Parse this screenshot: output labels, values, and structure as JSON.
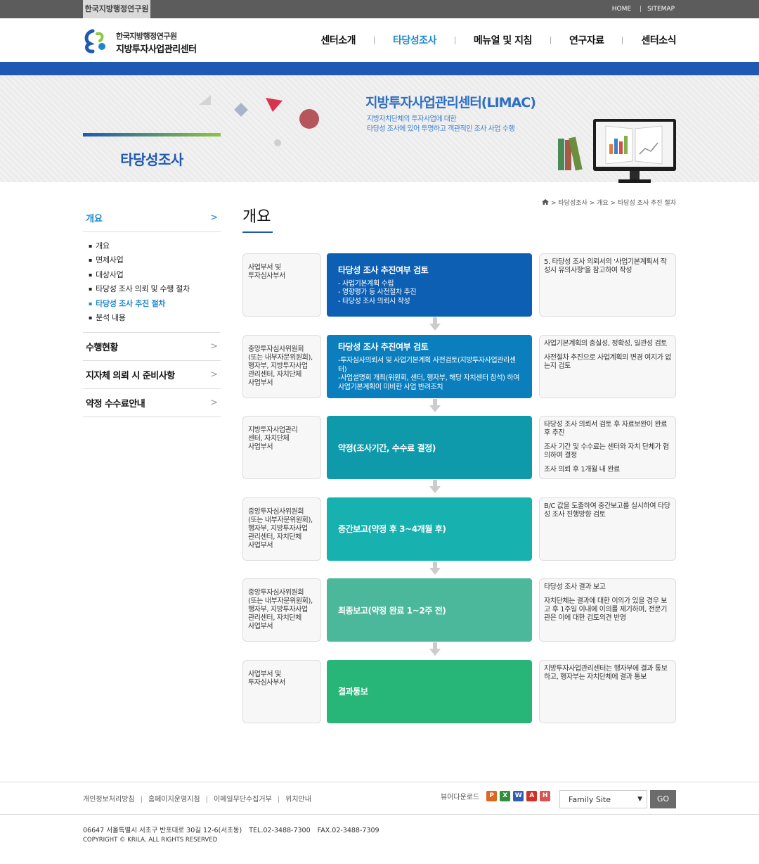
{
  "topbar": {
    "org_label": "한국지방행정연구원",
    "home": "HOME",
    "sitemap": "SITEMAP"
  },
  "header": {
    "logo_line1": "한국지방행정연구원",
    "logo_line2": "지방투자사업관리센터",
    "nav": [
      {
        "label": "센터소개",
        "active": false
      },
      {
        "label": "타당성조사",
        "active": true
      },
      {
        "label": "메뉴얼 및 지침",
        "active": false
      },
      {
        "label": "연구자료",
        "active": false
      },
      {
        "label": "센터소식",
        "active": false
      }
    ]
  },
  "banner": {
    "heading": "타당성조사",
    "center_title": "지방투자사업관리센터(LIMAC)",
    "center_desc_1": "지방자치단체의 투자사업에 대한",
    "center_desc_2": "타당성 조사에 있어 투명하고 객관적인 조사 사업 수행"
  },
  "sidebar": {
    "head": "개요",
    "sub_items": [
      {
        "label": "개요",
        "active": false
      },
      {
        "label": "면제사업",
        "active": false
      },
      {
        "label": "대상사업",
        "active": false
      },
      {
        "label": "타당성 조사 의뢰 및 수행 절차",
        "active": false
      },
      {
        "label": "타당성 조사 추진 절차",
        "active": true
      },
      {
        "label": "분석 내용",
        "active": false
      }
    ],
    "menu": [
      "수행현황",
      "지자체 의뢰 시 준비사항",
      "약정 수수료안내"
    ]
  },
  "breadcrumb": "> 타당성조사 > 개요 > 타당성 조사 추진 절차",
  "content": {
    "title": "개요",
    "steps": [
      {
        "left": [
          "사업부서 및",
          "투자심사부서"
        ],
        "title": "타당성 조사 추진여부 검토",
        "lines": [
          "- 사업기본계획 수립",
          "- 영향평가 등 사전절차 추진",
          "- 타당성 조사 의뢰시 작성"
        ],
        "right": [
          "5. 타당성 조사 의뢰서의 '사업기본계획서 작성시 유의사항'을 참고하여 작성"
        ],
        "color": "#0d5fb3"
      },
      {
        "left": [
          "중앙투자심사위원회",
          "(또는 내부자문위원회),",
          "행자부, 지방투자사업",
          "관리센터, 자치단체",
          "사업부서"
        ],
        "title": "타당성 조사 추진여부 검토",
        "lines": [
          "-투자심사의뢰서 및 사업기본계획 사전검토(지방투자사업관리센터)",
          "-사업설명회 개최(위원회, 센터, 행자부, 해당 자치센터 참석) 하여 사업기본계획이 미비한 사업 반려조치"
        ],
        "right": [
          "사업기본계획의 충실성, 정확성, 일관성 검토",
          "사전절차 추진으로 사업계획의 변경 여지가 없는지 검토"
        ],
        "color": "#0b7fbd"
      },
      {
        "left": [
          "지방투자사업관리",
          "센터, 자치단체",
          "사업부서"
        ],
        "title": "약정(조사기간, 수수료 결정)",
        "lines": [],
        "right": [
          "타당성 조사 의뢰서 검토 후 자료보완이 완료 후 추진",
          "조사 기간 및 수수료는 센터와 자치 단체가 협의하여 결정",
          "조사 의뢰 후 1개월 내 완료"
        ],
        "color": "#0e9aab"
      },
      {
        "left": [
          "중앙투자심사위원회",
          "(또는 내부자문위원회),",
          "행자부, 지방투자사업",
          "관리센터, 자치단체",
          "사업부서"
        ],
        "title": "중간보고(약정 후 3~4개월 후)",
        "lines": [],
        "right": [
          "B/C 값을 도출하여 중간보고를 실시하여 타당성 조사 진행방향 검토"
        ],
        "color": "#17b2b0"
      },
      {
        "left": [
          "중앙투자심사위원회",
          "(또는 내부자문위원회),",
          "행자부, 지방투자사업",
          "관리센터, 자치단체",
          "사업부서"
        ],
        "title": "최종보고(약정 완료 1~2주 전)",
        "lines": [],
        "right": [
          "타당성 조사 결과 보고",
          "자치단체는 결과에 대한 이의가 있을 경우 보고 후 1주일 이내에 이의를 제기하며, 전문기관은 이에 대한 검토의견 반영"
        ],
        "color": "#4bb79b"
      },
      {
        "left": [
          "사업부서 및",
          "투자심사부서"
        ],
        "title": "결과통보",
        "lines": [],
        "right": [
          "지방투자사업관리센터는 행자부에 결과 통보하고, 행자부는 자치단체에 결과 통보"
        ],
        "color": "#28b678"
      }
    ]
  },
  "footer": {
    "links": [
      "개인정보처리방침",
      "홈페이지운영지침",
      "이메일무단수집거부",
      "위치안내"
    ],
    "viewer_label": "뷰어다운로드",
    "family_site": "Family Site",
    "go": "GO",
    "address": "06647 서울특별시 서초구 반포대로 30길 12-6(서초동)",
    "tel": "TEL.02-3488-7300",
    "fax": "FAX.02-3488-7309",
    "copyright": "COPYRIGHT © KRILA. ALL RIGHTS RESERVED"
  }
}
